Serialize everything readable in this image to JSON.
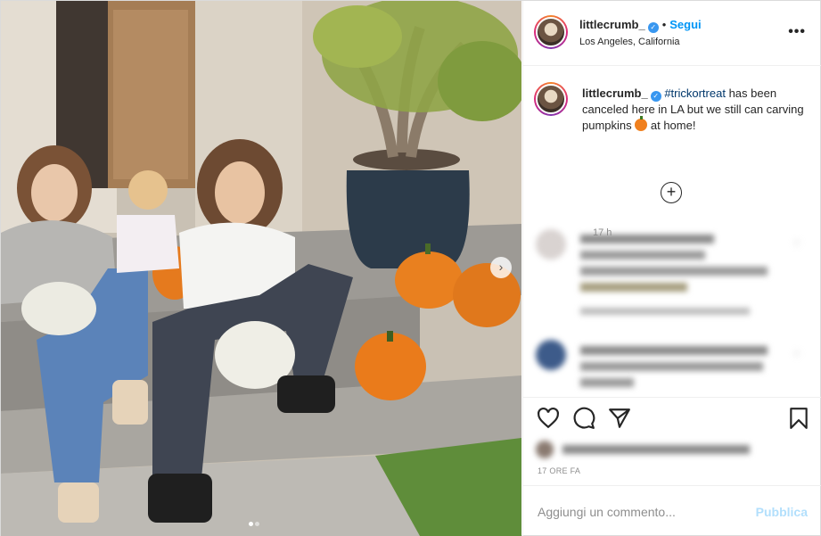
{
  "post": {
    "username": "littlecrumb_",
    "follow_label": "Segui",
    "separator": "•",
    "location": "Los Angeles, California",
    "more_label": "•••"
  },
  "caption": {
    "username": "littlecrumb_",
    "hashtag": "#trickortreat",
    "text": " has been canceled here in LA but we still can carving pumpkins ",
    "after_emoji": " at home!",
    "time": "17 h"
  },
  "load_more_label": "+",
  "actions": {
    "time_ago": "17 ORE FA"
  },
  "add_comment": {
    "placeholder": "Aggiungi un commento...",
    "publish_label": "Pubblica"
  },
  "colors": {
    "link": "#0095f6",
    "hashtag": "#00376b",
    "verified": "#3897f0"
  },
  "icons": [
    "verified-badge-icon",
    "more-options-icon",
    "plus-circle-icon",
    "heart-icon",
    "comment-icon",
    "share-icon",
    "bookmark-icon",
    "next-arrow-icon"
  ]
}
